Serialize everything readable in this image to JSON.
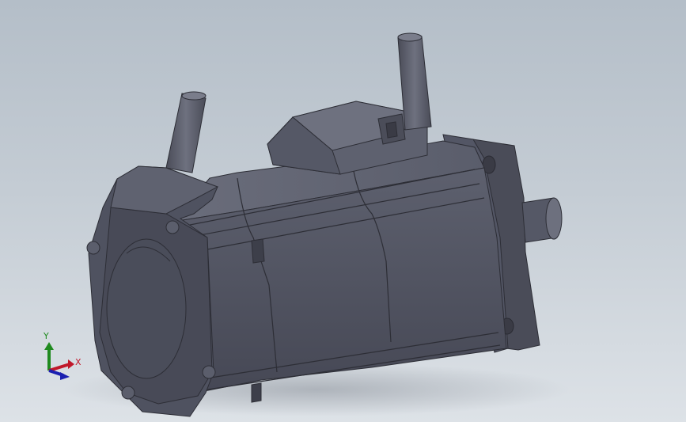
{
  "viewport": {
    "background_top": "#b4bec8",
    "background_bottom": "#dde2e7",
    "model_color": "#4d4f5c"
  },
  "triad": {
    "x_label": "X",
    "y_label": "Y",
    "x_color": "#c0182a",
    "y_color": "#1f8a1f",
    "z_color": "#1a1fb0"
  }
}
